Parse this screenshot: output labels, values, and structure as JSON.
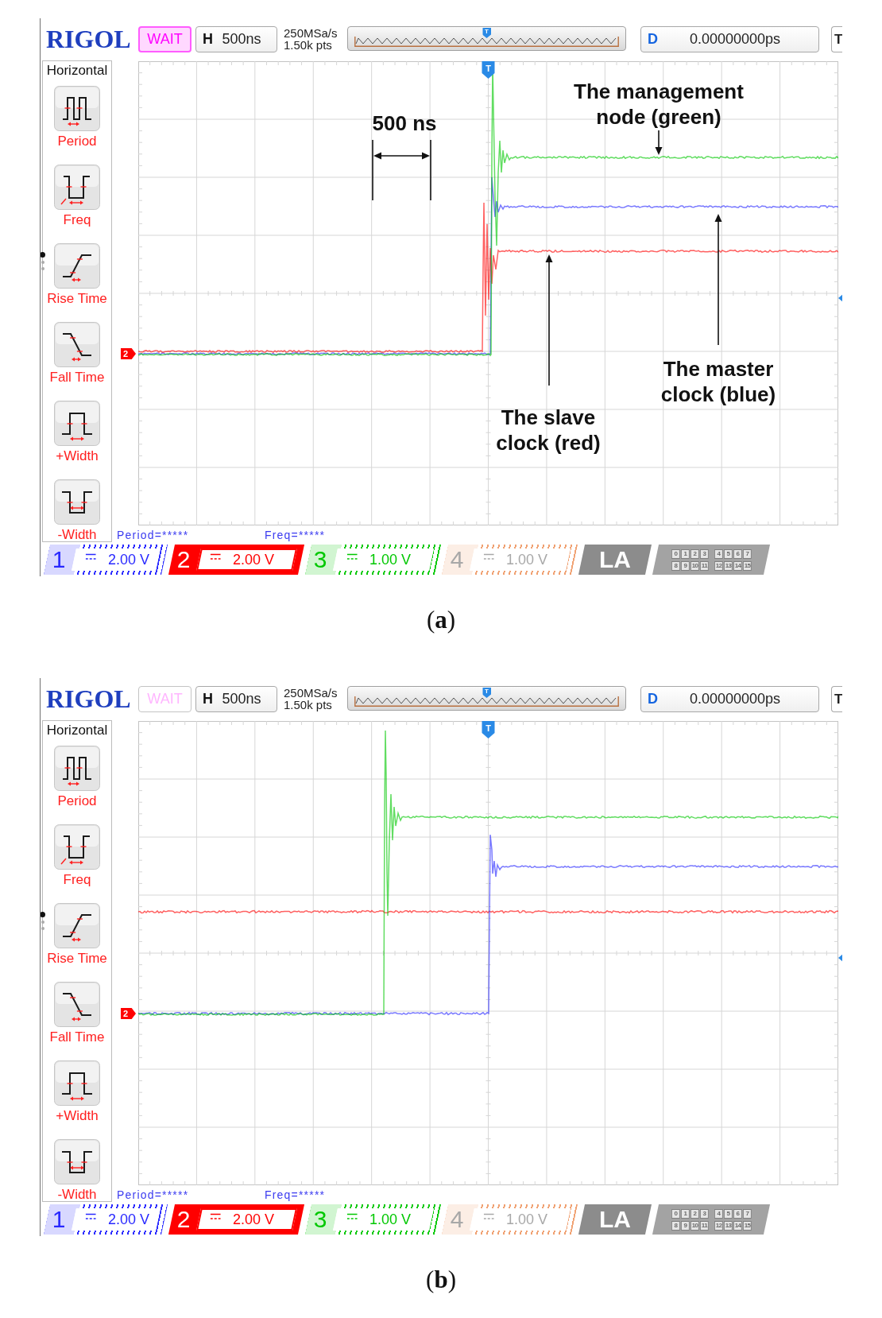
{
  "figures": [
    {
      "scope": {
        "logo": "RIGOL",
        "run_status": {
          "label": "WAIT",
          "highlighted": true
        },
        "timebase": {
          "label": "H",
          "value": "500ns"
        },
        "sample_rate": "250MSa/s",
        "memory_depth": "1.50k pts",
        "overview_marker": "T",
        "delay": {
          "label": "D",
          "value": "0.00000000ps"
        },
        "trigger_menu": "T",
        "menu": {
          "title": "Horizontal",
          "items": [
            {
              "label": "Period",
              "kind": "period"
            },
            {
              "label": "Freq",
              "kind": "frequency"
            },
            {
              "label": "Rise Time",
              "kind": "rise_time"
            },
            {
              "label": "Fall Time",
              "kind": "fall_time"
            },
            {
              "label": "+Width",
              "kind": "positive_width"
            },
            {
              "label": "-Width",
              "kind": "negative_width"
            }
          ],
          "pages": [
            {
              "selected": true
            },
            {
              "selected": false
            },
            {
              "selected": false
            }
          ]
        },
        "trigger_marker": "T",
        "channel_marker": "2",
        "annotations": [
          {
            "kind": "dimension",
            "text": "500 ns"
          },
          {
            "kind": "callout",
            "text": "The management\nnode (green)"
          },
          {
            "kind": "callout",
            "text": "The slave\nclock (red)"
          },
          {
            "kind": "callout",
            "text": "The master\nclock (blue)"
          }
        ],
        "readouts": [
          "Period=*****",
          "Freq=*****"
        ],
        "channels": [
          {
            "number": "1",
            "scale": "2.00 V",
            "color": "#2929ff",
            "selected": false,
            "on": true
          },
          {
            "number": "2",
            "scale": "2.00 V",
            "color": "#ff0000",
            "selected": true,
            "on": true
          },
          {
            "number": "3",
            "scale": "1.00 V",
            "color": "#00c800",
            "selected": false,
            "on": true
          },
          {
            "number": "4",
            "scale": "1.00 V",
            "color": "#f0a070",
            "selected": false,
            "on": false
          }
        ],
        "logic_analyzer": {
          "label": "LA",
          "channel_groups": [
            [
              "0",
              "1",
              "2",
              "3"
            ],
            [
              "4",
              "5",
              "6",
              "7"
            ],
            [
              "8",
              "9",
              "10",
              "11"
            ],
            [
              "12",
              "13",
              "14",
              "15"
            ]
          ]
        }
      },
      "caption": "(**a**)"
    },
    {
      "scope": {
        "logo": "RIGOL",
        "run_status": {
          "label": "WAIT",
          "highlighted": false
        },
        "timebase": {
          "label": "H",
          "value": "500ns"
        },
        "sample_rate": "250MSa/s",
        "memory_depth": "1.50k pts",
        "overview_marker": "T",
        "delay": {
          "label": "D",
          "value": "0.00000000ps"
        },
        "trigger_menu": "T",
        "menu": {
          "title": "Horizontal",
          "items": [
            {
              "label": "Period",
              "kind": "period"
            },
            {
              "label": "Freq",
              "kind": "frequency"
            },
            {
              "label": "Rise Time",
              "kind": "rise_time"
            },
            {
              "label": "Fall Time",
              "kind": "fall_time"
            },
            {
              "label": "+Width",
              "kind": "positive_width"
            },
            {
              "label": "-Width",
              "kind": "negative_width"
            }
          ],
          "pages": [
            {
              "selected": true
            },
            {
              "selected": false
            },
            {
              "selected": false
            }
          ]
        },
        "trigger_marker": "T",
        "channel_marker": "2",
        "readouts": [
          "Period=*****",
          "Freq=*****"
        ],
        "channels": [
          {
            "number": "1",
            "scale": "2.00 V",
            "color": "#2929ff",
            "selected": false,
            "on": true
          },
          {
            "number": "2",
            "scale": "2.00 V",
            "color": "#ff0000",
            "selected": true,
            "on": true
          },
          {
            "number": "3",
            "scale": "1.00 V",
            "color": "#00c800",
            "selected": false,
            "on": true
          },
          {
            "number": "4",
            "scale": "1.00 V",
            "color": "#f0a070",
            "selected": false,
            "on": false
          }
        ],
        "logic_analyzer": {
          "label": "LA",
          "channel_groups": [
            [
              "0",
              "1",
              "2",
              "3"
            ],
            [
              "4",
              "5",
              "6",
              "7"
            ],
            [
              "8",
              "9",
              "10",
              "11"
            ],
            [
              "12",
              "13",
              "14",
              "15"
            ]
          ]
        }
      },
      "caption": "(**b**)"
    }
  ]
}
